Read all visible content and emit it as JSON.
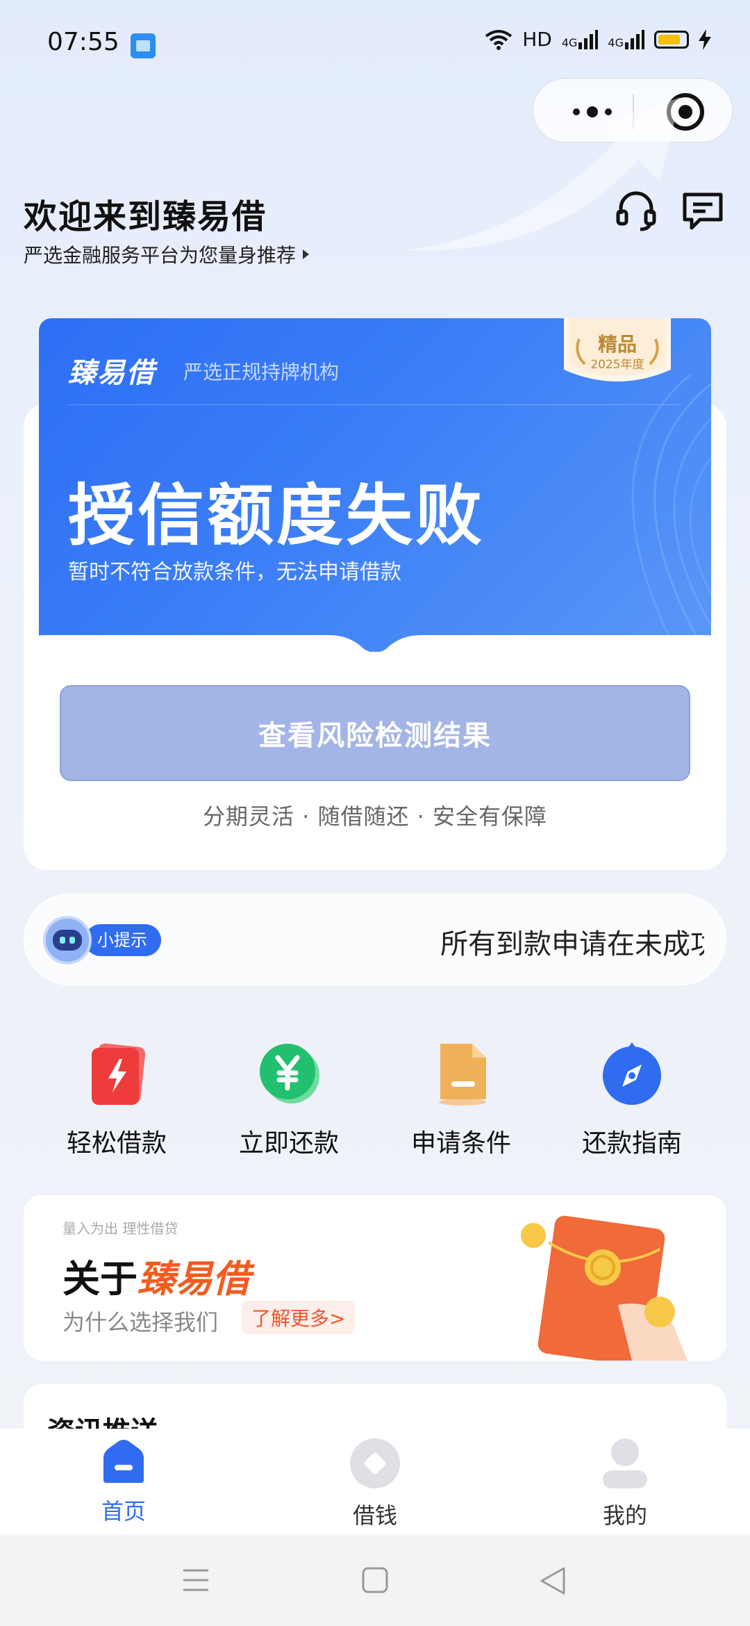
{
  "status_bar": {
    "time": "07:55",
    "network": "HD",
    "signal_1": "4G",
    "signal_2": "4G"
  },
  "header": {
    "welcome": "欢迎来到臻易借",
    "subtitle": "严选金融服务平台为您量身推荐"
  },
  "credit_card": {
    "brand": "臻易借",
    "brand_sub": "严选正规持牌机构",
    "badge_title": "精品",
    "badge_year": "2025年度",
    "status_title": "授信额度失败",
    "status_desc": "暂时不符合放款条件，无法申请借款",
    "button_label": "查看风险检测结果",
    "features": "分期灵活 · 随借随还 · 安全有保障"
  },
  "tip": {
    "pill": "小提示",
    "text": "所有到款申请在未成功"
  },
  "quick_actions": [
    {
      "label": "轻松借款",
      "icon": "lightning-card-icon"
    },
    {
      "label": "立即还款",
      "icon": "yuan-coin-icon"
    },
    {
      "label": "申请条件",
      "icon": "document-icon"
    },
    {
      "label": "还款指南",
      "icon": "compass-icon"
    }
  ],
  "about": {
    "tag": "量入为出 理性借贷",
    "title_prefix": "关于",
    "title_brand": "臻易借",
    "why": "为什么选择我们",
    "more": "了解更多>"
  },
  "news": {
    "title": "资讯推送"
  },
  "tabbar": {
    "items": [
      {
        "label": "首页",
        "active": true
      },
      {
        "label": "借钱",
        "active": false
      },
      {
        "label": "我的",
        "active": false
      }
    ]
  },
  "colors": {
    "accent": "#2f6cf0",
    "brand_orange": "#f25c1e",
    "button_disabled": "#a3b5e6"
  }
}
